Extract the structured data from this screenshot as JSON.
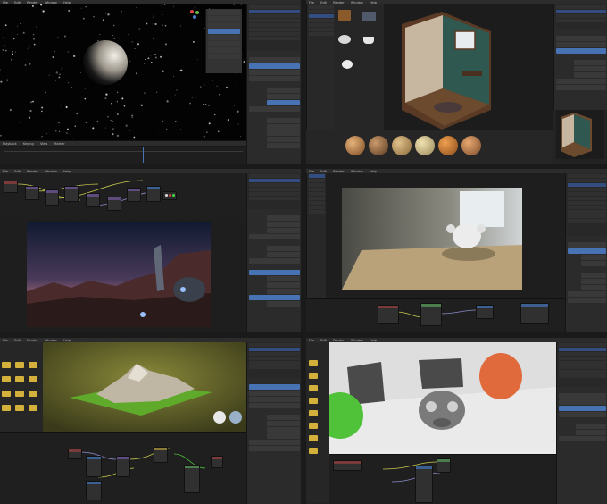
{
  "panels": [
    {
      "id": "p1",
      "menu": [
        "File",
        "Edit",
        "Render",
        "Window",
        "Help"
      ],
      "footer": [
        "Playback",
        "Keying",
        "View",
        "Marker"
      ]
    },
    {
      "id": "p2",
      "menu": [
        "File",
        "Edit",
        "Render",
        "Window",
        "Help"
      ]
    },
    {
      "id": "p3",
      "menu": [
        "File",
        "Edit",
        "Render",
        "Window",
        "Help"
      ],
      "tabs": [
        "Layout",
        "Modeling",
        "Sculpting",
        "UV Editing",
        "Texture Paint",
        "Shading",
        "Animation",
        "Rendering",
        "Compositing",
        "Scripting"
      ]
    },
    {
      "id": "p4",
      "menu": [
        "File",
        "Edit",
        "Render",
        "Window",
        "Help"
      ]
    },
    {
      "id": "p5",
      "menu": [
        "File",
        "Edit",
        "Render",
        "Window",
        "Help"
      ]
    },
    {
      "id": "p6",
      "menu": [
        "File",
        "Edit",
        "Render",
        "Window",
        "Help"
      ]
    }
  ],
  "colors": {
    "accent": "#4772b3",
    "folder": "#d4b13a",
    "orange": "#e06a3c",
    "green": "#4fc23a"
  },
  "icons": [
    "folder-icon",
    "material-ball-icon",
    "teapot-icon",
    "book-icon",
    "laptop-icon",
    "cup-icon",
    "gizmo-icon"
  ]
}
